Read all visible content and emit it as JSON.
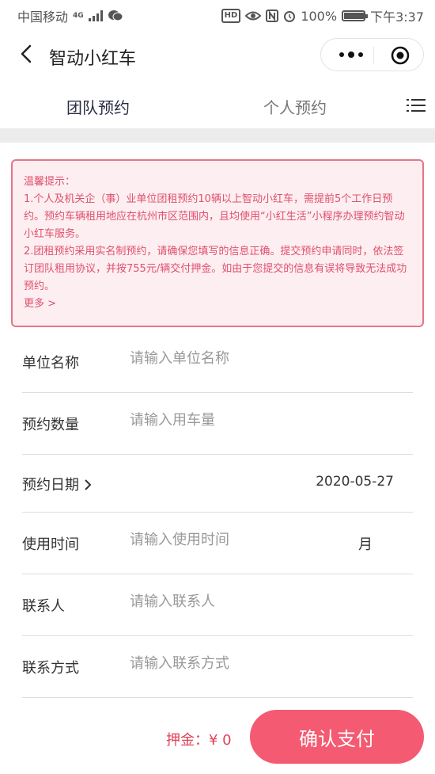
{
  "status_bar": {
    "carrier": "中国移动",
    "network": "4G",
    "battery": "100%",
    "battery_level": 1.0,
    "time": "下午3:37",
    "hd_label": "HD"
  },
  "nav": {
    "title": "智动小红车"
  },
  "tabs": [
    {
      "label": "团队预约",
      "active": true
    },
    {
      "label": "个人预约",
      "active": false
    }
  ],
  "notice": {
    "heading": "温馨提示：",
    "line1": "1.个人及机关企（事）业单位团租预约10辆以上智动小红车，需提前5个工作日预约。预约车辆租用地应在杭州市区范围内，且均使用“小红生活”小程序办理预约智动小红车服务。",
    "line2": "2.团租预约采用实名制预约，请确保您填写的信息正确。提交预约申请同时，依法签订团队租用协议，并按755元/辆交付押金。如由于您提交的信息有误将导致无法成功预约。",
    "more": "更多 >"
  },
  "form": {
    "company": {
      "label": "单位名称",
      "placeholder": "请输入单位名称"
    },
    "quantity": {
      "label": "预约数量",
      "placeholder": "请输入用车量"
    },
    "date": {
      "label": "预约日期",
      "value": "2020-05-27"
    },
    "duration": {
      "label": "使用时间",
      "placeholder": "请输入使用时间",
      "unit": "月"
    },
    "contact": {
      "label": "联系人",
      "placeholder": "请输入联系人"
    },
    "phone": {
      "label": "联系方式",
      "placeholder": "请输入联系方式"
    }
  },
  "footer": {
    "deposit": "押金：¥ 0",
    "pay_button": "确认支付"
  },
  "colors": {
    "accent": "#f45a72",
    "notice_text": "#e0506c",
    "notice_border": "#e5768a",
    "notice_bg": "#fdeef1"
  }
}
